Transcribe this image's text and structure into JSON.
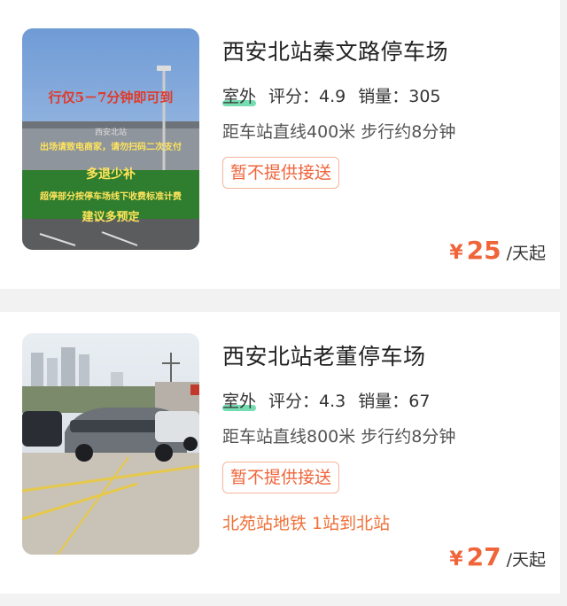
{
  "listings": [
    {
      "name": "西安北站秦文路停车场",
      "type_tag": "室外",
      "rating_text": "评分：4.9",
      "sales_text": "销量：305",
      "distance_text": "距车站直线400米 步行约8分钟",
      "badge": "暂不提供接送",
      "currency": "¥",
      "price": "25",
      "price_unit": "/天起",
      "photo_text": {
        "line1": "行仅5－7分钟即可到",
        "building_sign": "西安北站",
        "line2": "出场请致电商家，请勿扫码二次支付",
        "line3": "多退少补",
        "line4": "超停部分按停车场线下收费标准计费",
        "line5": "建议多预定"
      }
    },
    {
      "name": "西安北站老董停车场",
      "type_tag": "室外",
      "rating_text": "评分：4.3",
      "sales_text": "销量：67",
      "distance_text": "距车站直线800米 步行约8分钟",
      "badge": "暂不提供接送",
      "transit": "北苑站地铁 1站到北站",
      "currency": "¥",
      "price": "27",
      "price_unit": "/天起"
    }
  ],
  "colors": {
    "accent": "#f0643a",
    "outdoor_highlight": "#5ed6a4",
    "badge_border": "#f4b49a"
  }
}
